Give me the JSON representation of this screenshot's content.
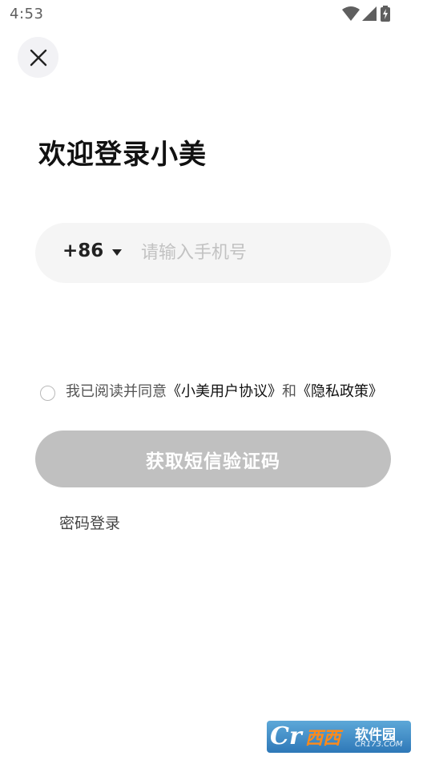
{
  "status_bar": {
    "time": "4:53",
    "icons": [
      "wifi-icon",
      "cell-signal-icon",
      "battery-charging-icon"
    ]
  },
  "header": {
    "close_icon": "close-icon"
  },
  "login": {
    "title": "欢迎登录小美",
    "country_code": "+86",
    "phone_placeholder": "请输入手机号",
    "phone_value": "",
    "agreement": {
      "prefix": "我已阅读并同意",
      "user_agreement": "《小美用户协议》",
      "and": "和",
      "privacy_policy": "《隐私政策》",
      "checked": false
    },
    "sms_button": "获取短信验证码",
    "password_login": "密码登录"
  },
  "watermark": {
    "logo": "Cr",
    "brand": "西西",
    "name": "软件园",
    "url": "CR173.COM"
  },
  "colors": {
    "button_disabled": "#c0c0c0",
    "input_bg": "#f5f5f5",
    "close_bg": "#f2f2f5"
  }
}
